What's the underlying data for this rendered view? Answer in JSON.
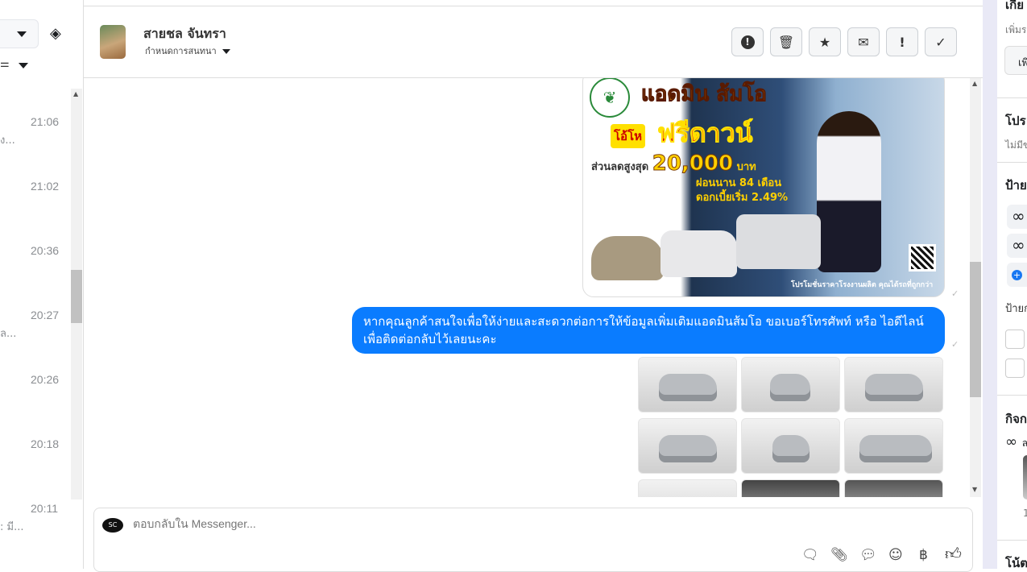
{
  "sidebar": {
    "times": [
      "21:06",
      "21:02",
      "20:36",
      "20:27",
      "20:26",
      "20:18",
      "20:11"
    ],
    "snippets": [
      "ง...",
      "ล...",
      ": มี..."
    ]
  },
  "header": {
    "contact_name": "สายชล จันทรา",
    "assign_label": "กำหนดการสนทนา",
    "actions": [
      "spam",
      "delete",
      "star",
      "mark-unread",
      "important",
      "done"
    ]
  },
  "messages": {
    "ad": {
      "brand": "แอดมิน ส้มโอ",
      "badge": "โอ้โห",
      "headline": "ฟรีดาวน์",
      "discount_label": "ส่วนลดสูงสุด",
      "discount_amount": "20,000",
      "currency": "บาท",
      "installment": "ผ่อนนาน 84 เดือน",
      "interest": "ดอกเบี้ยเริ่ม 2.49%",
      "footer": "โปรโมชั่นราคาโรงงานผลิต คุณได้รถที่ถูกกว่า"
    },
    "text_bubble": "หากคุณลูกค้าสนใจเพื่อให้ง่ายและสะดวกต่อการให้ข้อมูลเพิ่มเติมแอดมินส้มโอ ขอเบอร์โทรศัพท์ หรือ ไอดีไลน์ เพื่อติดต่อกลับไว้เลยนะคะ"
  },
  "composer": {
    "placeholder": "ตอบกลับใน Messenger..."
  },
  "right_panel": {
    "section1_title": "เกีย",
    "section1_sub": "เพิ่มร",
    "section1_button": "เพิ",
    "section2_title": "โปร",
    "section2_sub": "ไม่มีข",
    "section3_title": "ป้าย",
    "section3_sub": "ป้ายก",
    "section4_title": "กิจก",
    "section4_item": "ล",
    "section4_count": "1",
    "section5_title": "โน้ต"
  },
  "colors": {
    "accent": "#0a7cff"
  }
}
